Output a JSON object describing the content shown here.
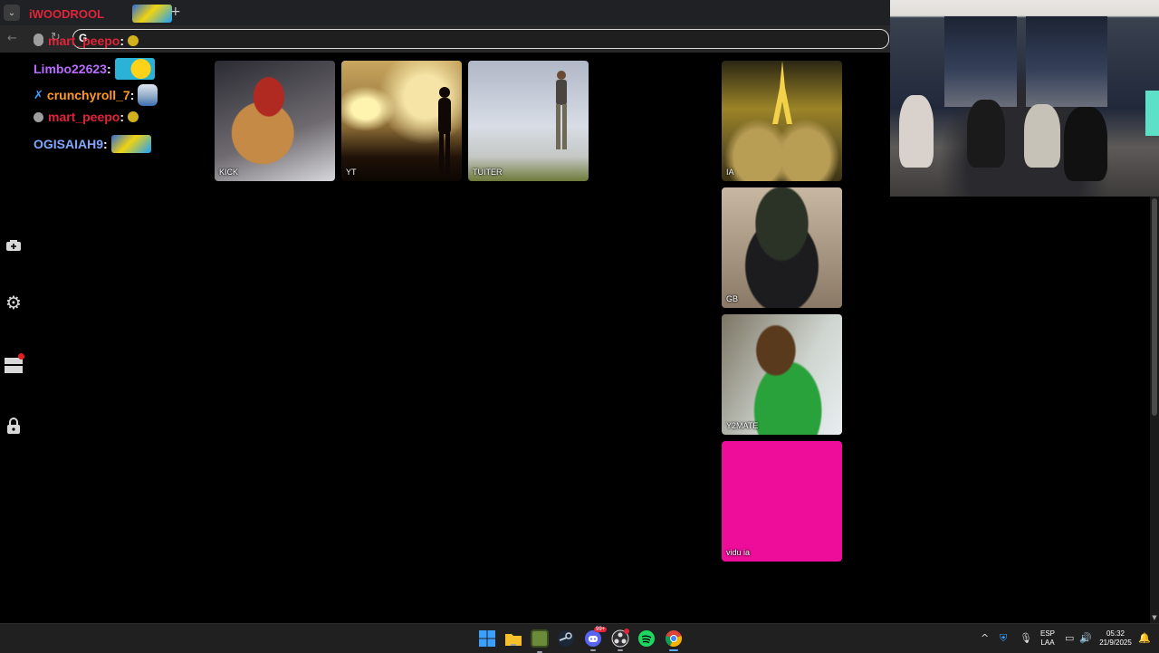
{
  "browser": {
    "tab_title": "iWOODROOL",
    "new_tab_label": "+",
    "tab_menu_label": "⌄",
    "omnibox_value": "",
    "omnibox_icon": "G"
  },
  "chat": [
    {
      "user": "mart_peepo",
      "color": "#e0243a",
      "badge": "gray-circle",
      "emote": "face"
    },
    {
      "user": "Limbo22623",
      "color": "#b96bff",
      "badge": "",
      "emote": "cheer"
    },
    {
      "user": "crunchyroll_7",
      "color": "#ff9a1c",
      "badge": "blade",
      "emote": "minion"
    },
    {
      "user": "mart_peepo",
      "color": "#e0243a",
      "badge": "gray-circle",
      "emote": "face"
    },
    {
      "user": "OGISAIAH9",
      "color": "#7fa7ff",
      "badge": "",
      "emote": "car"
    }
  ],
  "chat_separator": ":",
  "sidebar": {
    "icons": [
      "camera-icon",
      "gear-icon",
      "layers-icon",
      "lock-icon"
    ]
  },
  "tiles": [
    {
      "label": "KICK"
    },
    {
      "label": "YT"
    },
    {
      "label": "TUITER"
    },
    {
      "label": "IA"
    },
    {
      "label": "GB"
    },
    {
      "label": "Y2MATE"
    },
    {
      "label": "vidu ia",
      "color": "#ee0d9b"
    }
  ],
  "taskbar": {
    "apps": [
      "windows-start-icon",
      "file-explorer-icon",
      "minecraft-icon",
      "steam-icon",
      "discord-icon",
      "obs-icon",
      "spotify-icon",
      "chrome-icon"
    ],
    "discord_badge": "99+",
    "language_top": "ESP",
    "language_bottom": "LAA",
    "time": "05:32",
    "date": "21/9/2025"
  }
}
